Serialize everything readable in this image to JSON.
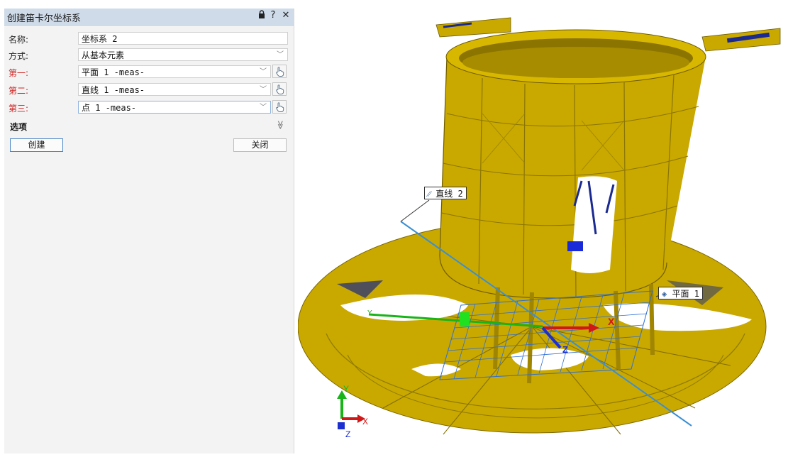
{
  "dialog": {
    "title": "创建笛卡尔坐标系",
    "icons": {
      "lock": "lock-icon",
      "help": "help-icon",
      "close": "close-icon"
    },
    "help_label": "?",
    "close_label": "✕"
  },
  "form": {
    "name_label": "名称:",
    "name_value": "坐标系 2",
    "method_label": "方式:",
    "method_value": "从基本元素",
    "first_label": "第一:",
    "first_value": "平面 1 -meas-",
    "second_label": "第二:",
    "second_value": "直线 1 -meas-",
    "third_label": "第三:",
    "third_value": "点 1 -meas-",
    "required_color": "#d02020"
  },
  "options": {
    "label": "选项",
    "toggle": "≫"
  },
  "buttons": {
    "create": "创建",
    "close": "关闭"
  },
  "viewport": {
    "callout_line": "直线 2",
    "callout_plane": "平面 1",
    "axis_x": "X",
    "axis_y": "Y",
    "axis_z": "Z",
    "model_color": "#c9a800",
    "colors": {
      "x": "#d01818",
      "y": "#18b418",
      "z": "#1c2fd0",
      "line": "#3a8fd4",
      "grid": "#2e6fd6"
    }
  }
}
